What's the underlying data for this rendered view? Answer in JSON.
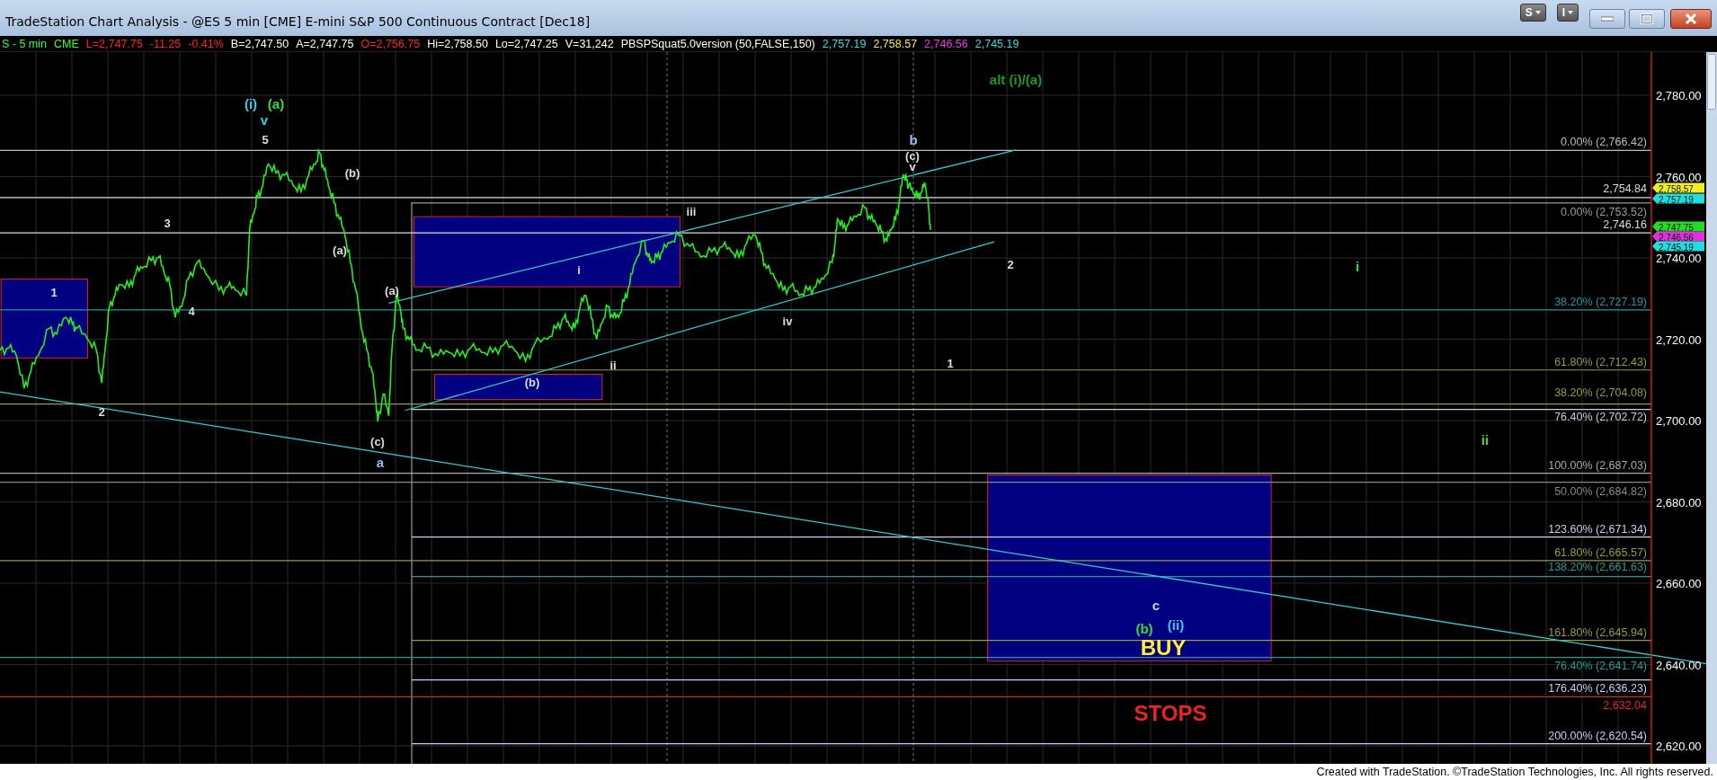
{
  "window": {
    "title": "TradeStation Chart Analysis - @ES 5 min [CME] E-mini S&P 500 Continuous Contract [Dec18]",
    "buttons": [
      {
        "kind": "dropdown",
        "label": "S"
      },
      {
        "kind": "dropdown",
        "label": "I"
      },
      {
        "kind": "minimize"
      },
      {
        "kind": "maximize"
      },
      {
        "kind": "close"
      }
    ]
  },
  "data_line": [
    {
      "text": "S - 5 min",
      "kind": "symbol"
    },
    {
      "text": "CME",
      "kind": "symbol"
    },
    {
      "text": "L=2,747.75",
      "kind": "down"
    },
    {
      "text": "-11.25",
      "kind": "down"
    },
    {
      "text": "-0.41%",
      "kind": "down"
    },
    {
      "text": "B=2,747.50",
      "kind": "quote"
    },
    {
      "text": "A=2,747.75",
      "kind": "quote"
    },
    {
      "text": "O=2,756.75",
      "kind": "down"
    },
    {
      "text": "Hi=2,758.50",
      "kind": "quote"
    },
    {
      "text": "Lo=2,747.25",
      "kind": "quote"
    },
    {
      "text": "V=31,242",
      "kind": "quote"
    },
    {
      "text": "PBSPSquat5.0version (50,FALSE,150)",
      "kind": "quote"
    },
    {
      "text": "2,757.19",
      "kind": "plot-cyan"
    },
    {
      "text": "2,758.57",
      "kind": "plot-yellow"
    },
    {
      "text": "2,746.56",
      "kind": "plot-magenta"
    },
    {
      "text": "2,745.19",
      "kind": "plot-cyan"
    }
  ],
  "chart": {
    "wave_labels": [
      {
        "text": "(i)",
        "color": "#33ccee",
        "kind": "major"
      },
      {
        "text": "(a)",
        "color": "#33dd33",
        "kind": "major"
      },
      {
        "text": "v",
        "color": "#33ccee",
        "kind": "major"
      },
      {
        "text": "5",
        "color": "#dddddd",
        "kind": "minor"
      },
      {
        "text": "3",
        "color": "#dddddd",
        "kind": "minor"
      },
      {
        "text": "4",
        "color": "#dddddd",
        "kind": "minor"
      },
      {
        "text": "1",
        "color": "#dddddd",
        "kind": "minor"
      },
      {
        "text": "2",
        "color": "#dddddd",
        "kind": "minor"
      },
      {
        "text": "(b)",
        "color": "#dddddd",
        "kind": "minor"
      },
      {
        "text": "(a)",
        "color": "#dddddd",
        "kind": "minor"
      },
      {
        "text": "(a)",
        "color": "#dddddd",
        "kind": "minor"
      },
      {
        "text": "(c)",
        "color": "#dddddd",
        "kind": "minor"
      },
      {
        "text": "a",
        "color": "#99bbee",
        "kind": "major"
      },
      {
        "text": "(b)",
        "color": "#dddddd",
        "kind": "minor"
      },
      {
        "text": "i",
        "color": "#dddddd",
        "kind": "minor"
      },
      {
        "text": "ii",
        "color": "#dddddd",
        "kind": "minor"
      },
      {
        "text": "iii",
        "color": "#dddddd",
        "kind": "minor"
      },
      {
        "text": "iv",
        "color": "#dddddd",
        "kind": "minor"
      },
      {
        "text": "b",
        "color": "#99bbee",
        "kind": "major"
      },
      {
        "text": "(c)",
        "color": "#dddddd",
        "kind": "minor"
      },
      {
        "text": "v",
        "color": "#dddddd",
        "kind": "minor"
      },
      {
        "text": "1",
        "color": "#dddddd",
        "kind": "minor"
      },
      {
        "text": "2",
        "color": "#dddddd",
        "kind": "minor"
      },
      {
        "text": "alt (i)/(a)",
        "color": "#229922",
        "kind": "major"
      },
      {
        "text": "i",
        "color": "#33dd33",
        "kind": "major"
      },
      {
        "text": "ii",
        "color": "#33dd33",
        "kind": "major"
      },
      {
        "text": "c",
        "color": "#ccccdd",
        "kind": "major"
      },
      {
        "text": "(b)",
        "color": "#33dd33",
        "kind": "major"
      },
      {
        "text": "(ii)",
        "color": "#33ccee",
        "kind": "major"
      },
      {
        "text": "BUY",
        "color": "#ffee33",
        "kind": "note"
      },
      {
        "text": "STOPS",
        "color": "#ee2222",
        "kind": "note"
      }
    ],
    "fib_levels": [
      {
        "label": "0.00% (2,766.42)",
        "color": "#bbbbbb"
      },
      {
        "label": "2,754.84",
        "color": "#dddddd"
      },
      {
        "label": "0.00% (2,753.52)",
        "color": "#999999"
      },
      {
        "label": "2,746.16",
        "color": "#dddddd"
      },
      {
        "label": "38.20% (2,727.19)",
        "color": "#229999"
      },
      {
        "label": "61.80% (2,712.43)",
        "color": "#999944"
      },
      {
        "label": "38.20% (2,704.08)",
        "color": "#999944"
      },
      {
        "label": "76.40% (2,702.72)",
        "color": "#ccccdd"
      },
      {
        "label": "100.00% (2,687.03)",
        "color": "#aaaaaa"
      },
      {
        "label": "50.00% (2,684.82)",
        "color": "#888888"
      },
      {
        "label": "123.60% (2,671.34)",
        "color": "#ccccee"
      },
      {
        "label": "61.80% (2,665.57)",
        "color": "#999944"
      },
      {
        "label": "138.20% (2,661.63)",
        "color": "#229999"
      },
      {
        "label": "161.80% (2,645.94)",
        "color": "#999944"
      },
      {
        "label": "76.40% (2,641.74)",
        "color": "#229999"
      },
      {
        "label": "176.40% (2,636.23)",
        "color": "#ccccee"
      },
      {
        "label": "2,632.04",
        "color": "#ee2222"
      },
      {
        "label": "200.00% (2,620.54)",
        "color": "#ccccee"
      }
    ],
    "price_axis": [
      "2,780.00",
      "2,760.00",
      "2,740.00",
      "2,720.00",
      "2,700.00",
      "2,680.00",
      "2,660.00",
      "2,640.00",
      "2,620.00"
    ],
    "price_tags": [
      {
        "text": "2,758.57",
        "color": "#eeee22"
      },
      {
        "text": "2,757.19",
        "color": "#22dddd"
      },
      {
        "text": "2,747.75",
        "color": "#22dd22"
      },
      {
        "text": "2,746.56",
        "color": "#dd33dd"
      },
      {
        "text": "2,745.19",
        "color": "#22dddd"
      }
    ]
  },
  "footer": "Created with TradeStation. ©TradeStation Technologies, Inc. All rights reserved."
}
